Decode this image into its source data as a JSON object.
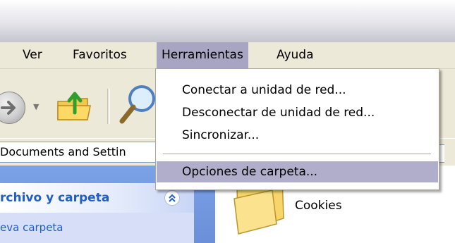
{
  "menu": {
    "items": [
      {
        "label": "Ver"
      },
      {
        "label": "Favoritos"
      },
      {
        "label": "Herramientas",
        "open": true
      },
      {
        "label": "Ayuda"
      }
    ]
  },
  "tools_menu": {
    "items": [
      "Conectar a unidad de red...",
      "Desconectar de unidad de red...",
      "Sincronizar..."
    ],
    "highlighted": "Opciones de carpeta..."
  },
  "address": {
    "value": "Documents and Settin"
  },
  "task_pane": {
    "title": "rchivo y carpeta",
    "link": "eva carpeta"
  },
  "content": {
    "folder": {
      "label": "Cookies",
      "icon": "folder-icon"
    }
  },
  "colors": {
    "menu_bg": "#ece9d8",
    "menu_highlight": "#a7a5c1",
    "task_pane_blue": "#6b8fd8",
    "task_title": "#215dc6"
  }
}
